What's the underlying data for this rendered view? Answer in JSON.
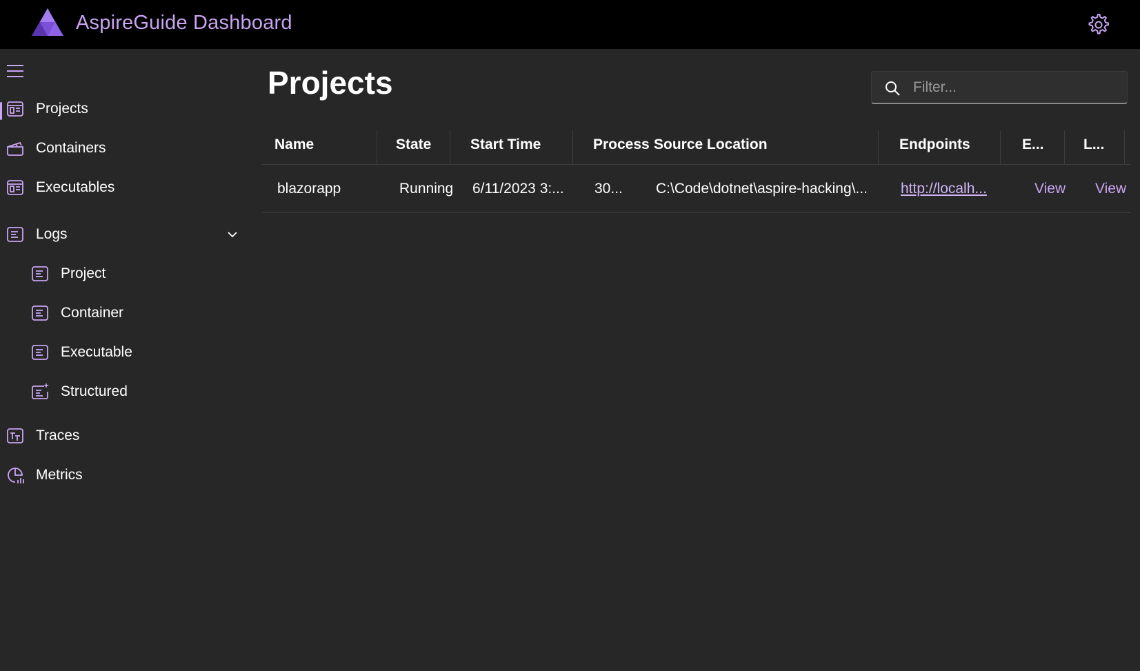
{
  "header": {
    "title": "AspireGuide Dashboard",
    "logo_icon": "aspire-logo-icon",
    "settings_icon": "gear-icon"
  },
  "sidebar": {
    "menu_icon": "hamburger-icon",
    "items": [
      {
        "label": "Projects",
        "icon": "projects-icon",
        "active": true
      },
      {
        "label": "Containers",
        "icon": "containers-icon"
      },
      {
        "label": "Executables",
        "icon": "executables-icon"
      },
      {
        "label": "Logs",
        "icon": "logs-icon",
        "expanded": true
      },
      {
        "label": "Project",
        "icon": "log-doc-icon"
      },
      {
        "label": "Container",
        "icon": "log-doc-icon"
      },
      {
        "label": "Executable",
        "icon": "log-doc-icon"
      },
      {
        "label": "Structured",
        "icon": "structured-log-icon"
      },
      {
        "label": "Traces",
        "icon": "traces-icon"
      },
      {
        "label": "Metrics",
        "icon": "metrics-icon"
      }
    ]
  },
  "main": {
    "title": "Projects",
    "filter": {
      "placeholder": "Filter...",
      "value": ""
    },
    "table": {
      "columns": [
        "Name",
        "State",
        "Start Time",
        "Process",
        "Source Location",
        "Endpoints",
        "E...",
        "L..."
      ],
      "rows": [
        {
          "name": "blazorapp",
          "state": "Running",
          "start_time": "6/11/2023 3:...",
          "process": "30...",
          "source_location": "C:\\Code\\dotnet\\aspire-hacking\\...",
          "endpoints": "http://localh...",
          "env": "View",
          "logs": "View"
        }
      ]
    }
  },
  "colors": {
    "accent": "#c9a4f2",
    "background": "#272727",
    "topbar": "#000000"
  }
}
